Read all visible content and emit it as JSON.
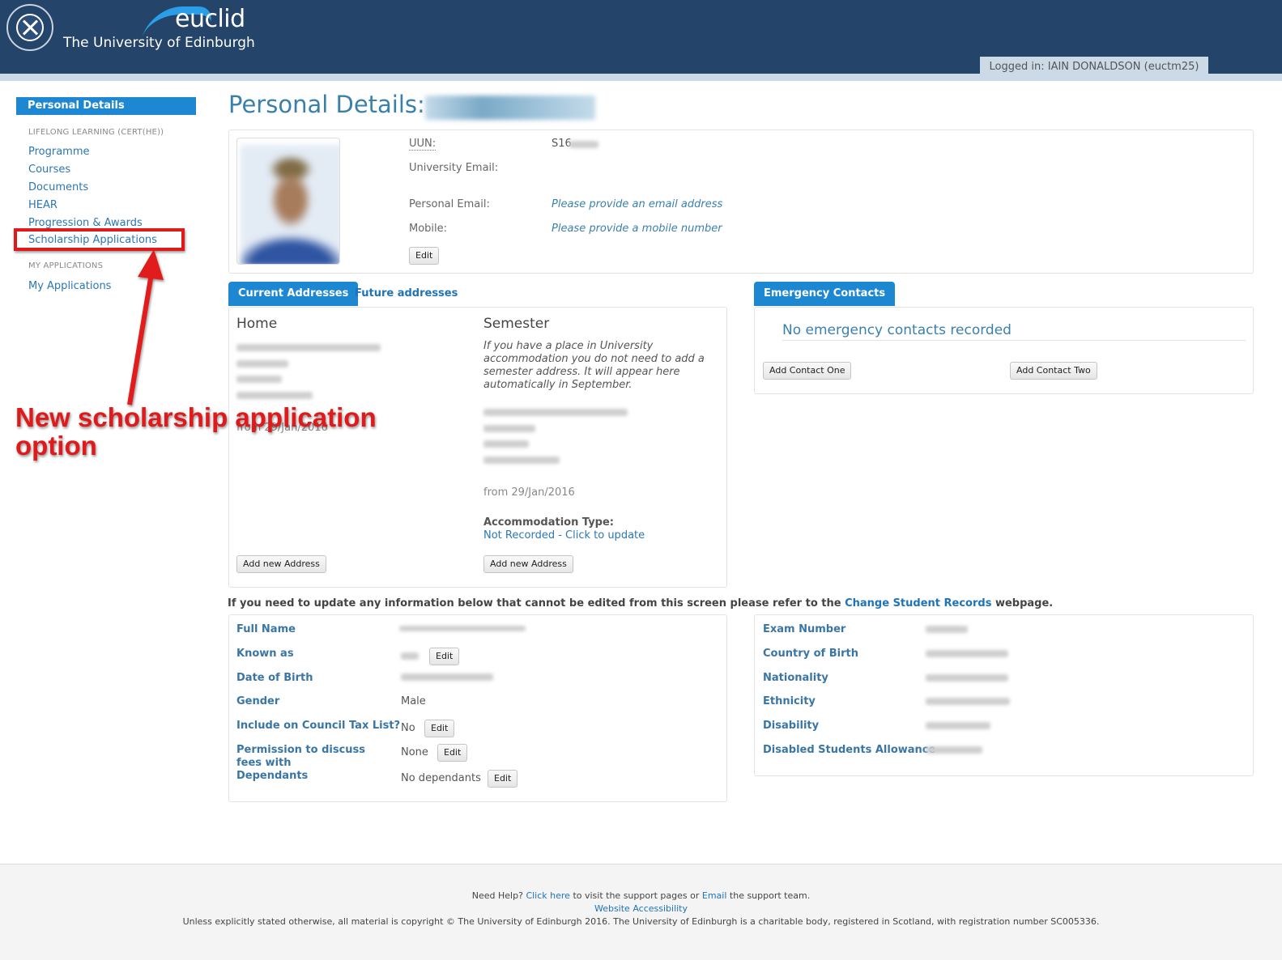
{
  "header": {
    "brand": "euclid",
    "university": "The University of Edinburgh",
    "logged_in": "Logged in: IAIN DONALDSON (euctm25)"
  },
  "sidebar": {
    "active": "Personal Details",
    "section1_heading": "LIFELONG LEARNING (CERT(HE))",
    "section1_items": [
      "Programme",
      "Courses",
      "Documents",
      "HEAR",
      "Progression & Awards",
      "Scholarship Applications"
    ],
    "section2_heading": "MY APPLICATIONS",
    "section2_items": [
      "My Applications"
    ]
  },
  "annotation": {
    "line1": "New scholarship application",
    "line2": "option",
    "color": "#e01a1a"
  },
  "main": {
    "title": "Personal Details:",
    "profile": {
      "uun_label": "UUN:",
      "uun_value": "S16",
      "uni_email_label": "University Email:",
      "personal_email_label": "Personal Email:",
      "personal_email_value": "Please provide an email address",
      "mobile_label": "Mobile:",
      "mobile_value": "Please provide a mobile number",
      "edit": "Edit"
    },
    "address_tabs": [
      "Current Addresses",
      "Future addresses"
    ],
    "home": {
      "heading": "Home",
      "from": "from 29/Jan/2016",
      "button": "Add new Address"
    },
    "semester": {
      "heading": "Semester",
      "note": "If you have a place in University accommodation you do not need to add a semester address. It will appear here automatically in September.",
      "from": "from 29/Jan/2016",
      "accommodation_label": "Accommodation Type:",
      "accommodation_link": "Not Recorded - Click to update",
      "button": "Add new Address"
    },
    "emergency": {
      "tab": "Emergency Contacts",
      "empty": "No emergency contacts recorded",
      "add_one": "Add Contact One",
      "add_two": "Add Contact Two"
    },
    "info": {
      "prefix": "If you need to update any information below that cannot be edited from this screen please refer to the",
      "link": "Change Student Records",
      "suffix": "webpage."
    },
    "details_left": {
      "full_name": "Full Name",
      "known_as": "Known as",
      "dob": "Date of Birth",
      "gender": "Gender",
      "gender_value": "Male",
      "council_tax": "Include on Council Tax List?",
      "council_tax_value": "No",
      "permission_fees": "Permission to discuss fees with",
      "permission_fees_value": "None",
      "dependants": "Dependants",
      "dependants_value": "No dependants",
      "edit": "Edit"
    },
    "details_right": {
      "labels": [
        "Exam Number",
        "Country of Birth",
        "Nationality",
        "Ethnicity",
        "Disability",
        "Disabled Students Allowance"
      ]
    }
  },
  "footer": {
    "help_prefix": "Need Help?",
    "click_here": "Click here",
    "help_mid": "to visit the support pages or",
    "email": "Email",
    "help_suffix": "the support team.",
    "accessibility": "Website Accessibility",
    "copyright": "Unless explicitly stated otherwise, all material is copyright © The University of Edinburgh 2016. The University of Edinburgh is a charitable body, registered in Scotland, with registration number SC005336."
  }
}
